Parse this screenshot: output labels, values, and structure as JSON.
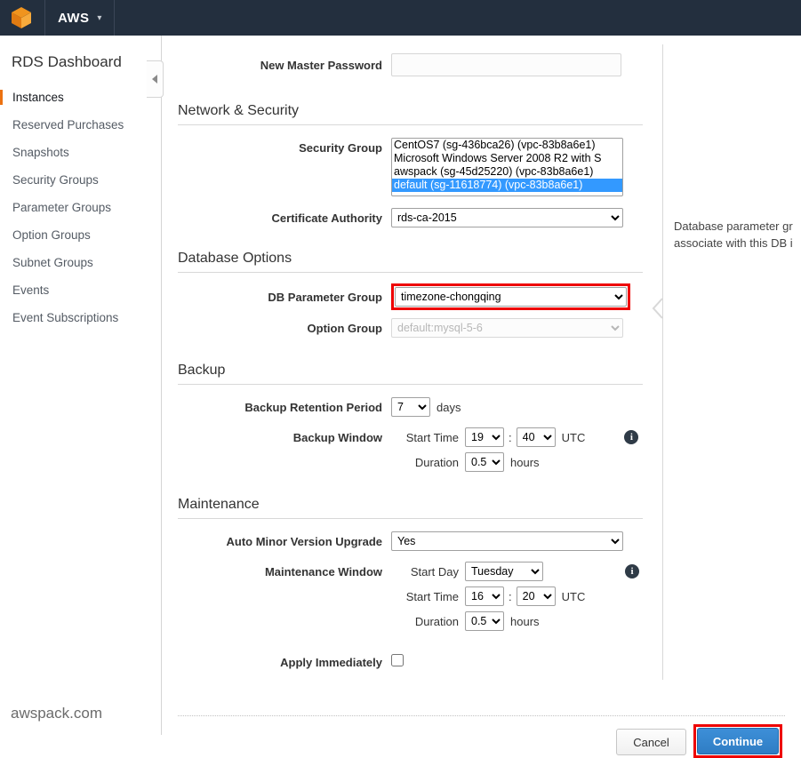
{
  "topbar": {
    "logo_alt": "aws-cube-logo",
    "brand": "AWS",
    "caret": "⌄"
  },
  "sidebar": {
    "title": "RDS Dashboard",
    "items": [
      {
        "label": "Instances",
        "active": true
      },
      {
        "label": "Reserved Purchases",
        "active": false
      },
      {
        "label": "Snapshots",
        "active": false
      },
      {
        "label": "Security Groups",
        "active": false
      },
      {
        "label": "Parameter Groups",
        "active": false
      },
      {
        "label": "Option Groups",
        "active": false
      },
      {
        "label": "Subnet Groups",
        "active": false
      },
      {
        "label": "Events",
        "active": false
      },
      {
        "label": "Event Subscriptions",
        "active": false
      }
    ],
    "watermark": "awspack.com"
  },
  "form": {
    "master_password": {
      "label": "New Master Password",
      "value": "",
      "placeholder": ""
    },
    "network_security": {
      "heading": "Network & Security",
      "security_group": {
        "label": "Security Group",
        "options": [
          "CentOS7 (sg-436bca26) (vpc-83b8a6e1)",
          "Microsoft Windows Server 2008 R2 with S",
          "awspack (sg-45d25220) (vpc-83b8a6e1)",
          "default (sg-11618774) (vpc-83b8a6e1)"
        ],
        "selected": "default (sg-11618774) (vpc-83b8a6e1)"
      },
      "certificate_authority": {
        "label": "Certificate Authority",
        "value": "rds-ca-2015"
      }
    },
    "database_options": {
      "heading": "Database Options",
      "db_parameter_group": {
        "label": "DB Parameter Group",
        "value": "timezone-chongqing",
        "highlighted": true,
        "highlight_color": "#ee0000"
      },
      "option_group": {
        "label": "Option Group",
        "value": "default:mysql-5-6",
        "disabled": true
      }
    },
    "backup": {
      "heading": "Backup",
      "retention": {
        "label": "Backup Retention Period",
        "value": "7",
        "unit": "days"
      },
      "window": {
        "label": "Backup Window",
        "start_time_label": "Start Time",
        "start_hour": "19",
        "start_minute": "40",
        "timezone": "UTC",
        "duration_label": "Duration",
        "duration": "0.5",
        "duration_unit": "hours"
      }
    },
    "maintenance": {
      "heading": "Maintenance",
      "auto_minor_version_upgrade": {
        "label": "Auto Minor Version Upgrade",
        "value": "Yes"
      },
      "window": {
        "label": "Maintenance Window",
        "start_day_label": "Start Day",
        "start_day": "Tuesday",
        "start_time_label": "Start Time",
        "start_hour": "16",
        "start_minute": "20",
        "timezone": "UTC",
        "duration_label": "Duration",
        "duration": "0.5",
        "duration_unit": "hours"
      }
    },
    "apply_immediately": {
      "label": "Apply Immediately",
      "checked": false
    }
  },
  "help_panel": {
    "line1": "Database parameter gr",
    "line2": "associate with this DB i"
  },
  "footer": {
    "cancel_label": "Cancel",
    "continue_label": "Continue",
    "continue_highlighted": true,
    "continue_color": "#2f7dc4"
  },
  "icons": {
    "info": "i"
  }
}
